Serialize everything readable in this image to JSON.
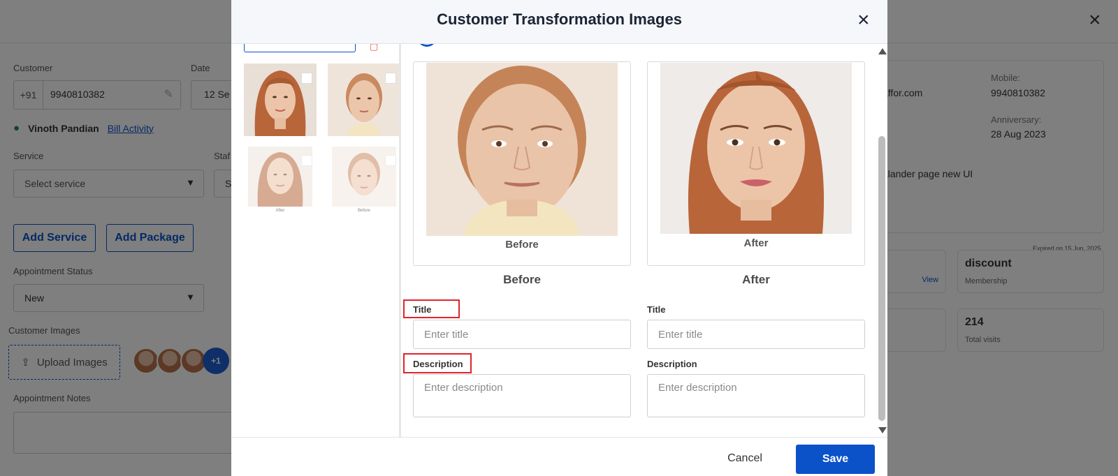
{
  "background": {
    "customer_label": "Customer",
    "country_code": "+91",
    "phone": "9940810382",
    "date_label": "Date",
    "date_value": "12 Se",
    "customer_name": "Vinoth Pandian",
    "bill_activity": "Bill Activity",
    "service_label": "Service",
    "service_placeholder": "Select service",
    "staff_label": "Staf",
    "staff_partial": "S",
    "add_service": "Add Service",
    "add_package": "Add Package",
    "status_label": "Appointment Status",
    "status_value": "New",
    "images_label": "Customer Images",
    "upload_images": "Upload Images",
    "more_count": "+1",
    "notes_label": "Appointment Notes",
    "email_partial": "affor.com",
    "mobile_label": "Mobile:",
    "mobile_value": "9940810382",
    "anniversary_label": "Anniversary:",
    "anniversary_value": "28 Aug 2023",
    "note_partial": "alander page new UI",
    "expired_text": "Expired on 15 Jun, 2025",
    "view_link": "View",
    "discount_title": "discount",
    "membership_sub": "Membership",
    "visits_count": "214",
    "visits_sub": "Total visits"
  },
  "modal": {
    "title": "Customer Transformation Images",
    "close_icon": "close-icon",
    "thumbnails": [
      {
        "kind": "after",
        "checked": false
      },
      {
        "kind": "before",
        "checked": false
      },
      {
        "kind": "after",
        "caption": "After",
        "faded": true
      },
      {
        "kind": "before",
        "caption": "Before",
        "faded": true
      }
    ],
    "before": {
      "photo_caption": "Before",
      "heading": "Before",
      "title_label": "Title",
      "title_placeholder": "Enter title",
      "description_label": "Description",
      "description_placeholder": "Enter description"
    },
    "after": {
      "photo_caption": "After",
      "heading": "After",
      "title_label": "Title",
      "title_placeholder": "Enter title",
      "description_label": "Description",
      "description_placeholder": "Enter description"
    },
    "cancel_label": "Cancel",
    "save_label": "Save"
  },
  "colors": {
    "primary": "#0b52c9",
    "highlight": "#e0242b",
    "hair": "#b8653a",
    "skin": "#e9c2a6"
  }
}
